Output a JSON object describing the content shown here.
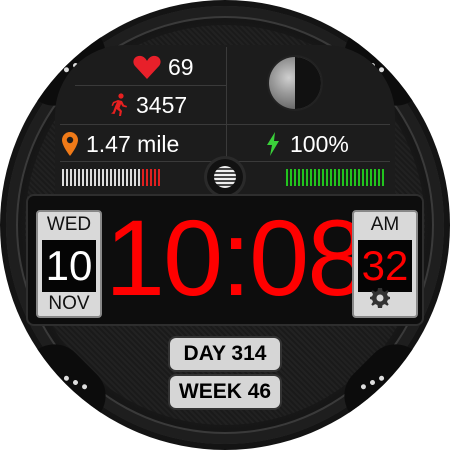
{
  "stats": {
    "heart_rate": "69",
    "steps": "3457",
    "distance": "1.47 mile",
    "battery": "100%"
  },
  "date": {
    "weekday": "WED",
    "day": "10",
    "month": "NOV"
  },
  "time": {
    "display": "10:08",
    "ampm": "AM",
    "seconds": "32"
  },
  "bottom": {
    "day_of_year": "DAY 314",
    "week": "WEEK 46"
  },
  "colors": {
    "accent_red": "#ff0000",
    "heart": "#e8202a",
    "steps_icon": "#e82020",
    "pin": "#f07a18",
    "bolt": "#3ad13a",
    "battery_bar": "#22c41e"
  },
  "icons": {
    "heart": "heart-icon",
    "steps": "running-person-icon",
    "distance": "location-pin-icon",
    "battery": "lightning-bolt-icon",
    "moon": "moon-phase-icon",
    "settings": "gear-icon"
  },
  "levels": {
    "steps_progress": 0.8,
    "battery_level": 1.0
  }
}
